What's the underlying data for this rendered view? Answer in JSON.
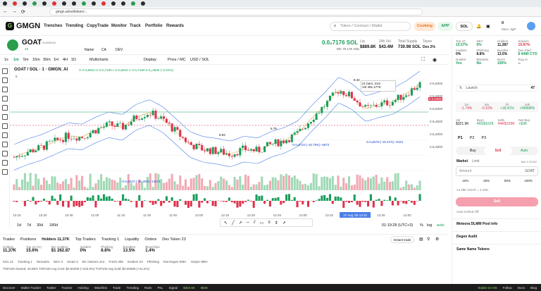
{
  "nav": {
    "logo": "GMGN",
    "links": [
      "Trenches",
      "Trending",
      "CopyTrade",
      "Monitor",
      "Track",
      "Portfolio",
      "Rewards"
    ],
    "search_placeholder": "Token / Contract / Wallet",
    "cooking_label": "Cooking",
    "app_label": "APP",
    "chain_label": "SOL",
    "balance": "0",
    "user_label": "Mom..dgP"
  },
  "token": {
    "symbol": "GOAT",
    "name": "Goatseus",
    "age": "33",
    "price": "0.0₆7176 SOL",
    "market_cap": "MC 70.17K SOL",
    "liq_label": "Liq",
    "liq_value": "$889.8K",
    "vol_label": "24h Vol",
    "vol_value": "$43.4M",
    "supply_label": "Total Supply",
    "supply_value": "730.98 SOL",
    "taxes_label": "Taxes",
    "taxes_value": "Dex 2%",
    "sub_tabs": [
      "Name",
      "CA",
      "DEV"
    ]
  },
  "toolbar": {
    "intervals": [
      "1s",
      "1m",
      "5m",
      "15m",
      "30m",
      "1H",
      "4H",
      "1D"
    ],
    "multicharts": "Multicharts",
    "display": "Display",
    "price_mc": "Price / MC",
    "usd_sol": "USD / SOL"
  },
  "chart_header": {
    "pair": "GOAT / SOL · 1 · GMGN_AI",
    "ohlc": "O 0.0₄6824  H 0.0₄7180  L 0.0₄6824  C 0.0₄7169  0.0₄₁3826 (+2.01%)",
    "indicators": "6"
  },
  "chart_data": {
    "type": "candlestick",
    "x_ticks": [
      "10:15",
      "10:30",
      "10:45",
      "11:00",
      "11:15",
      "11:30",
      "11:45",
      "12:00",
      "12:15",
      "12:30",
      "12:45",
      "13:00",
      "13:15",
      "27 Aug '25 13:32",
      "13:45",
      "14:00"
    ],
    "y_ticks": [
      "0.0₄5800",
      "0.0₄5000",
      "0.0₄4000"
    ],
    "price_ticks": [
      "0.0₄6000",
      "0.0₄5500",
      "0.0₄5000",
      "0.0₄4500",
      "0.0₄4000",
      "0.0₄3500"
    ],
    "annotations": [
      "21 bars, 21m",
      "Vol 481.177K",
      "-0.0₄6723 (-16.78%) -6872",
      "-0.0₄6578 (-15.41%) -9151",
      "-0.0₄2572 (-46.35%) -12571",
      "8.93",
      "6.79",
      "8.34"
    ],
    "close": [
      0.0434,
      0.0446,
      0.0455,
      0.0468,
      0.0481,
      0.0478,
      0.0493,
      0.0505,
      0.0499,
      0.0521,
      0.0532,
      0.0516,
      0.0489,
      0.0462,
      0.0451,
      0.0447,
      0.0441,
      0.0452,
      0.0448,
      0.0462,
      0.0471,
      0.0486,
      0.0519,
      0.0548,
      0.0581,
      0.0566,
      0.054,
      0.0549,
      0.0556,
      0.0573,
      0.0594
    ]
  },
  "chart_footer": {
    "ranges": [
      "1d",
      "7d",
      "30d",
      "180d"
    ],
    "clock": "01:19:28 (UTC+3)",
    "pct": "%",
    "log": "log",
    "auto": "auto"
  },
  "bottom": {
    "tabs": [
      "Trades",
      "Positions",
      "Holders 11,37K",
      "Top Traders",
      "Tracking 1",
      "Liquidity",
      "Orders",
      "Dev Token 23"
    ],
    "instant": "Instant trade",
    "stats": [
      {
        "label": "Holders",
        "value": "11,37K"
      },
      {
        "label": "Top 10 (%)",
        "value": "15.6%"
      },
      {
        "label": "MC Holders",
        "value": "$1 262.87"
      },
      {
        "label": "Insiders",
        "value": "0%"
      },
      {
        "label": "Phishing",
        "value": "8.8%"
      },
      {
        "label": "Bundlers",
        "value": "13.5%"
      },
      {
        "label": "BlueChips",
        "value": "1.4%"
      }
    ],
    "subtabs": [
      "KOL 21",
      "Tracking 1",
      "Remarks",
      "DEV 3",
      "Smart 3",
      "BC Owners 214",
      "Fresh 308",
      "Insiders 23",
      "Phishing",
      "Rat Degen 999+",
      "Sniper 999+"
    ],
    "trade_row": "TOP100 Owned: 40.68%   TOP100 Avg Cost: $0.00409 (+103.9%)   TOP100 Avg Sold: $0.00586 (+44.2%)"
  },
  "right": {
    "top": [
      {
        "label": "Top 10",
        "value": "15.57%",
        "status": "green"
      },
      {
        "label": "DEV",
        "value": "0%",
        "status": "green"
      },
      {
        "label": "Holders",
        "value": "11,387",
        "status": "none"
      },
      {
        "label": "Snipers",
        "value": "19.87%",
        "status": "red"
      },
      {
        "label": "Insiders",
        "value": "0%",
        "status": "none"
      },
      {
        "label": "Phishing",
        "value": "8.8%",
        "status": "none"
      },
      {
        "label": "Bundler",
        "value": "13.5%",
        "status": "none"
      },
      {
        "label": "Dex Paid",
        "value": "$ 4490 CTO",
        "status": "green"
      },
      {
        "label": "NoMint",
        "value": "Yes",
        "status": "green"
      },
      {
        "label": "Blacklist",
        "value": "No",
        "status": "green"
      },
      {
        "label": "Burnt",
        "value": "100%",
        "status": "green"
      },
      {
        "label": "Rug %",
        "value": "--",
        "status": "none"
      }
    ],
    "launch": "Launch",
    "launch_value": "47",
    "perf": [
      {
        "label": "1m",
        "value": "-1.74%"
      },
      {
        "label": "5m",
        "value": "-0.10%"
      },
      {
        "label": "1h",
        "value": "+18.41%"
      },
      {
        "label": "24h",
        "value": "+99898%"
      }
    ],
    "vol_label": "Vol",
    "vol_value": "$321.9K",
    "buys_label": "Buys",
    "buys_value": "493/$162K",
    "sells_label": "Sells",
    "sells_value": "444/$159K",
    "netbuy_label": "Net Buy",
    "netbuy_value": "+$3K",
    "presets": [
      "P1",
      "P2",
      "P3"
    ],
    "buy": "Buy",
    "sell": "Sell",
    "auto": "Auto",
    "market": "Market",
    "limit": "Limit",
    "bal": "Bal: 0 GOAT",
    "amount": "Amount",
    "amount_unit": "GOAT",
    "pcts": [
      "10%",
      "25%",
      "50%",
      "100%"
    ],
    "rate": "14.29K GOAT = 1 SOL",
    "sell_btn": "Sell",
    "footer_row": "Auto  0.0015  Off",
    "section1": "Meteora DLMM Pool info",
    "section2": "Degen Audit",
    "section3": "Same Name Tokens"
  },
  "taskbar": {
    "items": [
      "Discover",
      "Wallet Tracker",
      "Twitter",
      "Tracker",
      "Holding",
      "Watchlist",
      "Trade",
      "Trending",
      "Rank",
      "PnL",
      "Signal",
      "$394.6K",
      "$84K"
    ],
    "status": "Stable S4 MS",
    "right": [
      "Follow",
      "Docs",
      "Blog"
    ]
  }
}
